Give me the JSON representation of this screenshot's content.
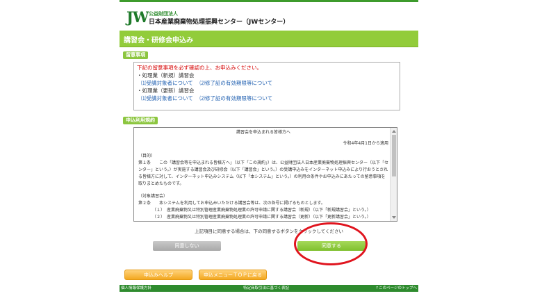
{
  "logo": {
    "mark": "JW",
    "small": "公益財団法人",
    "big": "日本産業廃棄物処理振興センター（JWセンター）"
  },
  "title": "講習会・研修会申込み",
  "notice": {
    "tab": "留意事項",
    "warning": "下記の留意事項を必ず確認の上、お申込みください。",
    "course1": "・処理業（新規）講習会",
    "course1_link1": "⑴受講対象者について",
    "course1_link2": "⑵修了証の有効期限等について",
    "course2": "・処理業（更新）講習会",
    "course2_link1": "⑴受講対象者について",
    "course2_link2": "⑵修了証の有効期限等について"
  },
  "terms": {
    "tab": "申込利用規約",
    "heading": "講習会を申込まれる皆様方へ",
    "effective": "令和4年4月1日から適用",
    "purpose_head": "（目的）",
    "article1": "第１条　　この「講習会等を申込まれる皆様方へ」（以下「この規約」）は、公益財団法人日本産業廃棄物処理振興センター（以下「センター」という。）が実施する講習会及び研修会（以下「講習会」という。）の受講申込みをインターネット申込みにより行おうとされる皆様方に対して、インターネット申込みシステム（以下「本システム」という。）の利用の条件やお申込みにあたっての留意事項を取りまとめたものです。",
    "target_head": "（対象講習会）",
    "article2": "第２条　　本システムを利用してお申込みいただける講習会等は、次の各号に掲げるものとします。",
    "item1": "（１）　産業廃棄物又は特別管理産業廃棄物処理業の許可申請に関する講習会（新規）（以下「新規講習会」という。）",
    "item2": "（２）　産業廃棄物又は特別管理産業廃棄物処理業の許可申請に関する講習会（更新）（以下「更新講習会」という。）"
  },
  "instruction": "上記項目に同意する場合は、下の同意するボタンをクリックしてください",
  "buttons": {
    "disagree": "同意しない",
    "agree": "同意する",
    "help": "申込みヘルプ",
    "menu": "申込メニューＴＯＰに戻る"
  },
  "footer": {
    "privacy": "個人情報保護方針",
    "law": "特定商取引法に基づく表記",
    "top": "↑このページのトップへ"
  }
}
